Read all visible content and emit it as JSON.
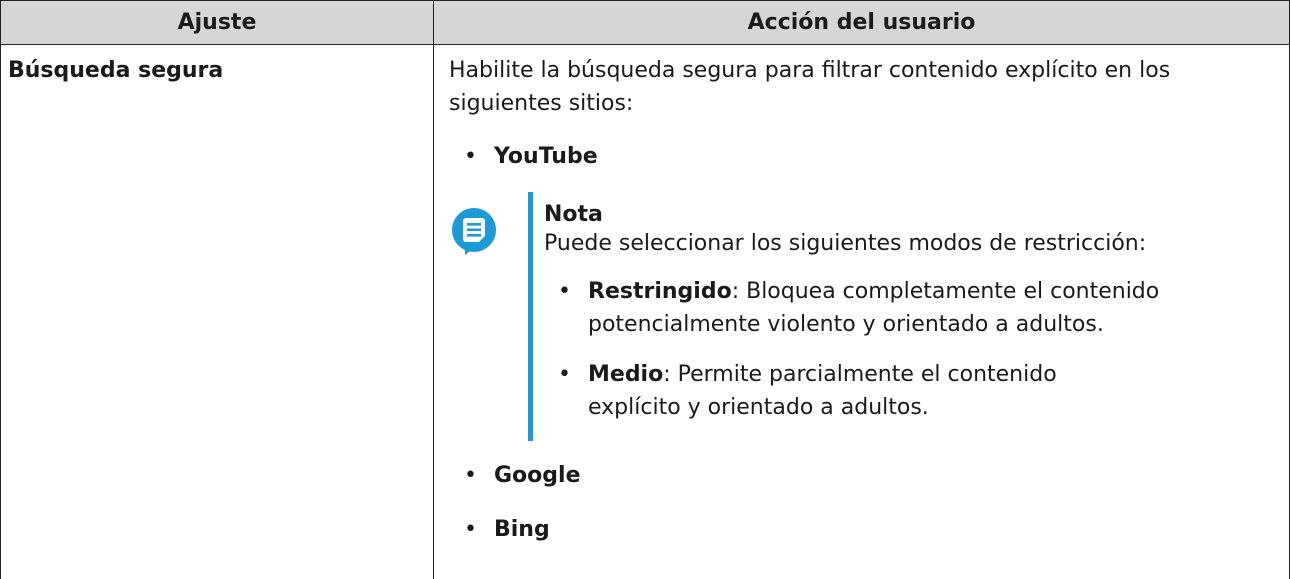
{
  "table": {
    "headers": {
      "setting": "Ajuste",
      "action": "Acción del usuario"
    },
    "row": {
      "setting": "Búsqueda segura",
      "intro": "Habilite la búsqueda segura para filtrar contenido explícito en los siguientes sitios:",
      "sites": {
        "youtube": "YouTube",
        "google": "Google",
        "bing": "Bing"
      },
      "note": {
        "icon": "note-icon",
        "title": "Nota",
        "text": "Puede seleccionar los siguientes modos de restricción:",
        "modes": [
          {
            "name": "Restringido",
            "sep": ":",
            "desc_line1": " Bloquea completamente el contenido",
            "desc_line2": "potencialmente violento y orientado a adultos."
          },
          {
            "name": "Medio",
            "sep": ":",
            "desc_line1": " Permite parcialmente el contenido",
            "desc_line2": "explícito y orientado a adultos."
          }
        ]
      },
      "bullet_symbol": "•"
    }
  },
  "colors": {
    "header_bg": "#d6d6d6",
    "note_accent": "#1b9ad6",
    "border": "#222222"
  }
}
